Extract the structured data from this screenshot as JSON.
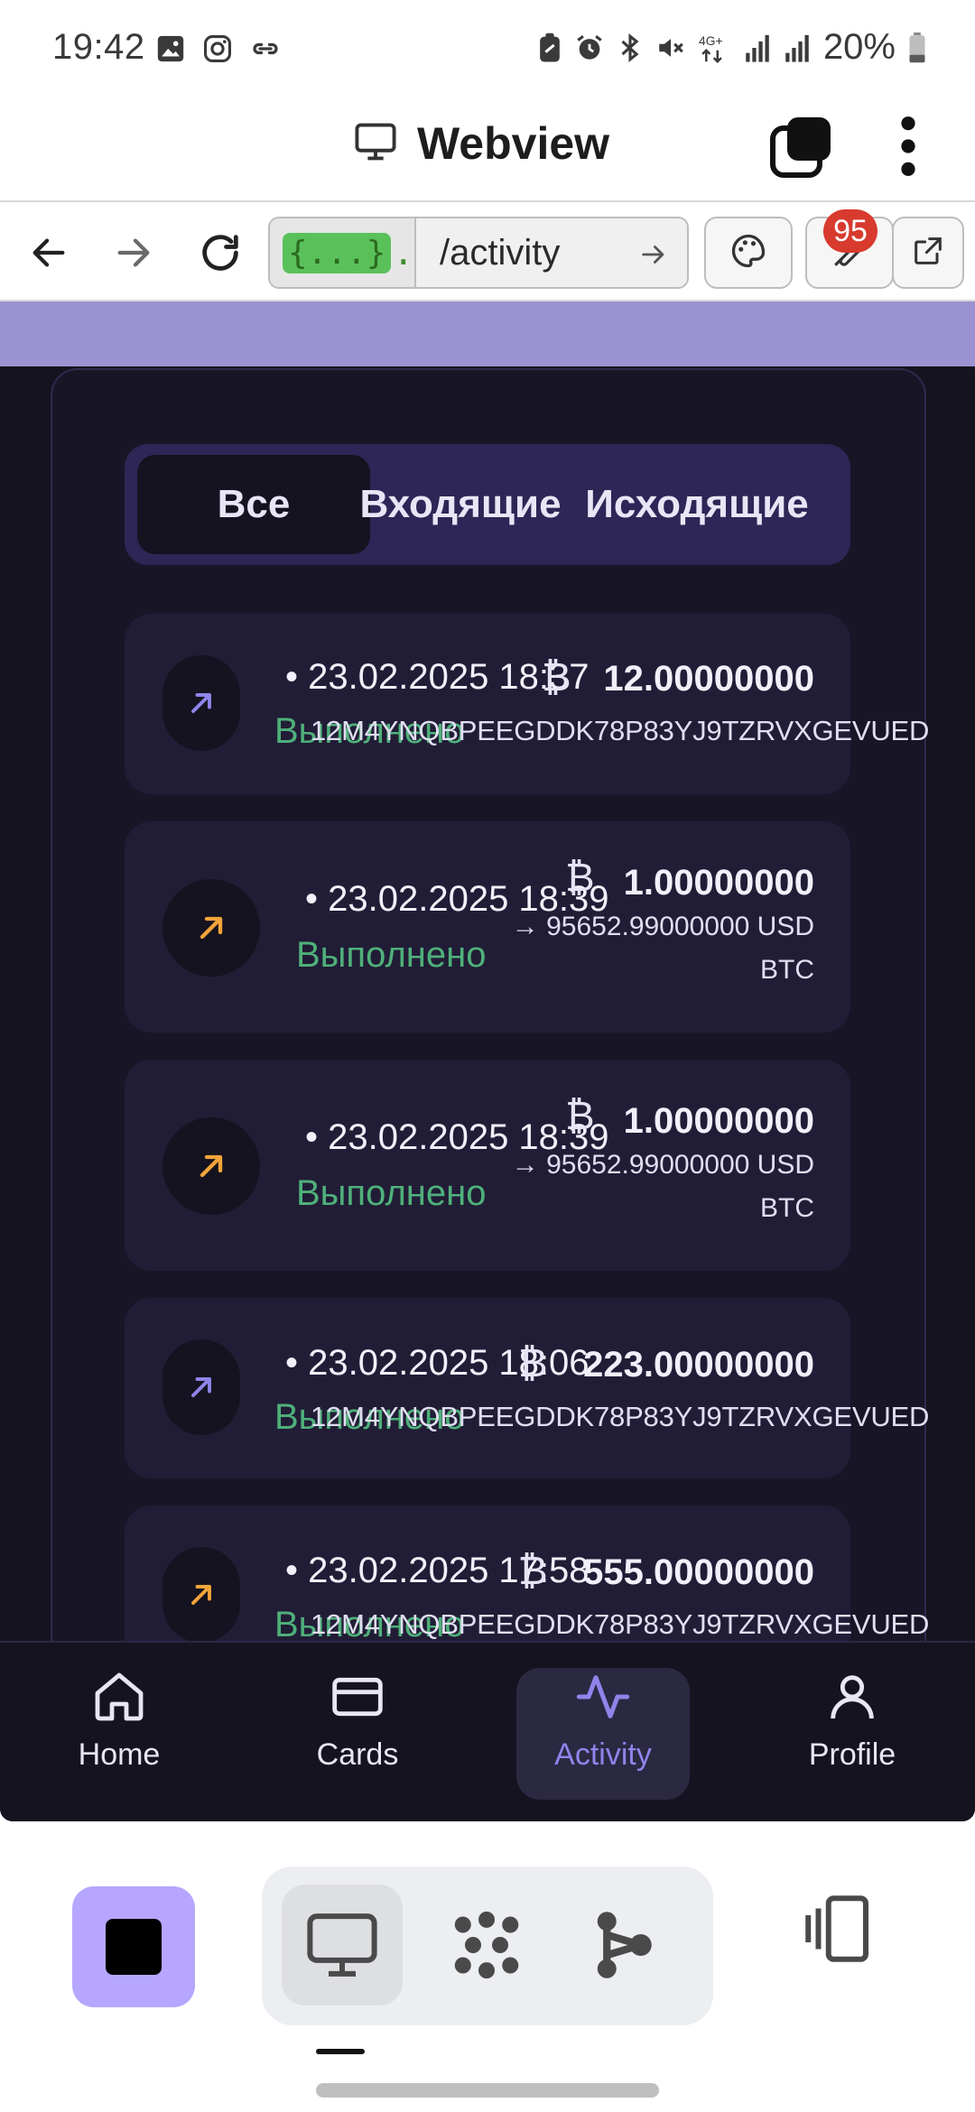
{
  "status_bar": {
    "time": "19:42",
    "battery_text": "20%",
    "network_label": "4G+",
    "left_icons": [
      "image-icon",
      "instagram-icon",
      "link-icon"
    ],
    "right_icons": [
      "lock-note-icon",
      "alarm-icon",
      "bluetooth-icon",
      "mute-icon",
      "network-4g-icon",
      "signal-icon",
      "signal-icon",
      "battery-icon"
    ]
  },
  "app_header": {
    "title": "Webview",
    "icons": [
      "monitor-icon",
      "tabs-stack-icon",
      "more-vert-icon"
    ]
  },
  "toolbar": {
    "host_badge": "{...}",
    "host_text": ".rep",
    "path": "/activity",
    "devtools_badge": "95",
    "icons": [
      "back-arrow-icon",
      "forward-arrow-icon",
      "reload-icon",
      "go-arrow-icon",
      "palette-icon",
      "tools-icon",
      "open-external-icon"
    ]
  },
  "filter_tabs": {
    "items": [
      "Все",
      "Входящие",
      "Исходящие"
    ],
    "active": "Все"
  },
  "transactions": [
    {
      "date": "• 23.02.2025 18:37",
      "status": "Выполнено",
      "currency_symbol": "₿",
      "amount": "12.00000000",
      "address": "12M4YNQBPEEGDDK78P83YJ9TZRVXGEVUED",
      "direction_color": "#8f84ea"
    },
    {
      "date": "• 23.02.2025 18:39",
      "status": "Выполнено",
      "currency_symbol": "₿",
      "amount": "1.00000000",
      "conversion": "→ 95652.99000000 USD",
      "asset": "BTC",
      "direction_color": "#f1a43a"
    },
    {
      "date": "• 23.02.2025 18:39",
      "status": "Выполнено",
      "currency_symbol": "₿",
      "amount": "1.00000000",
      "conversion": "→ 95652.99000000 USD",
      "asset": "BTC",
      "direction_color": "#f1a43a"
    },
    {
      "date": "• 23.02.2025 18:06",
      "status": "Выполнено",
      "currency_symbol": "₿",
      "amount": "223.00000000",
      "address": "12M4YNQBPEEGDDK78P83YJ9TZRVXGEVUED",
      "direction_color": "#8f84ea"
    },
    {
      "date": "• 23.02.2025 17:58",
      "status": "Выполнено",
      "currency_symbol": "₿",
      "amount": "555.00000000",
      "address": "12M4YNQBPEEGDDK78P83YJ9TZRVXGEVUED",
      "direction_color": "#f1a43a"
    }
  ],
  "bottom_nav": {
    "items": [
      {
        "label": "Home",
        "icon": "home-icon"
      },
      {
        "label": "Cards",
        "icon": "card-icon"
      },
      {
        "label": "Activity",
        "icon": "activity-icon"
      },
      {
        "label": "Profile",
        "icon": "profile-icon"
      }
    ],
    "active": "Activity",
    "active_color": "#8f84ea"
  },
  "dock": {
    "icons": [
      "stop-icon",
      "monitor-icon",
      "grid-dots-icon",
      "share-node-icon",
      "split-screen-icon"
    ],
    "accent": "#b6a6ff"
  }
}
